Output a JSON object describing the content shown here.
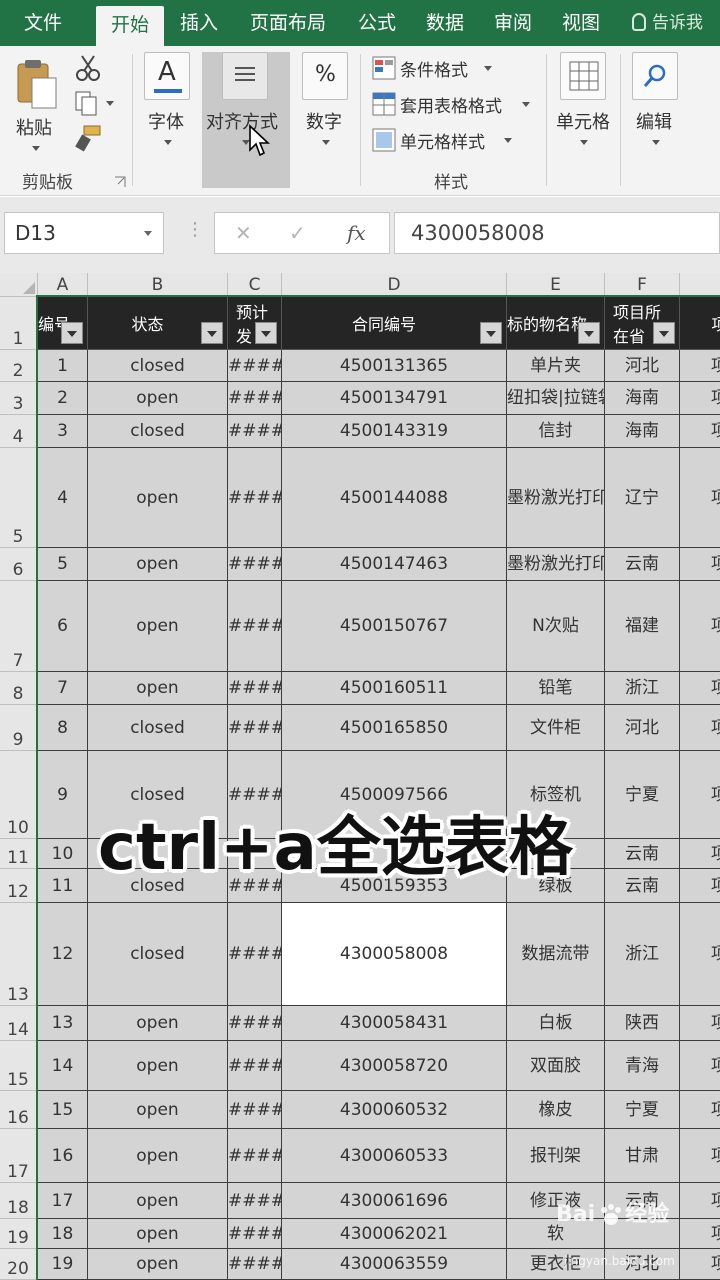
{
  "menu": {
    "tabs": [
      "文件",
      "开始",
      "插入",
      "页面布局",
      "公式",
      "数据",
      "审阅",
      "视图"
    ],
    "active_tab": "开始",
    "tell_me": "告诉我"
  },
  "ribbon": {
    "clipboard": {
      "paste": "粘贴",
      "group": "剪贴板"
    },
    "font": {
      "label": "字体",
      "icon": "A"
    },
    "alignment": {
      "label": "对齐方式"
    },
    "number": {
      "label": "数字",
      "icon": "%"
    },
    "styles": {
      "conditional": "条件格式",
      "table": "套用表格格式",
      "cell_styles": "单元格样式",
      "group": "样式"
    },
    "cells": {
      "label": "单元格"
    },
    "editing": {
      "label": "编辑"
    }
  },
  "formula_bar": {
    "name_box": "D13",
    "cancel": "✕",
    "enter": "✓",
    "fx": "fx",
    "value": "4300058008"
  },
  "columns": [
    "A",
    "B",
    "C",
    "D",
    "E",
    "F"
  ],
  "headers": {
    "A": "编号",
    "B": "状态",
    "C1": "预计",
    "C2": "发",
    "D": "合同编号",
    "E": "标的物名称",
    "F1": "项目所",
    "F2": "在省",
    "G": "项"
  },
  "rows": [
    {
      "n": "2",
      "a": "1",
      "b": "closed",
      "c": "####",
      "d": "4500131365",
      "e": "单片夹",
      "f": "河北",
      "g": "项"
    },
    {
      "n": "3",
      "a": "2",
      "b": "open",
      "c": "####",
      "d": "4500134791",
      "e": "纽扣袋|拉链袋",
      "f": "海南",
      "g": "项"
    },
    {
      "n": "4",
      "a": "3",
      "b": "closed",
      "c": "####",
      "d": "4500143319",
      "e": "信封",
      "f": "海南",
      "g": "项"
    },
    {
      "n": "5",
      "a": "4",
      "b": "open",
      "c": "####",
      "d": "4500144088",
      "e": "墨粉激光打印机",
      "f": "辽宁",
      "g": "项"
    },
    {
      "n": "6",
      "a": "5",
      "b": "open",
      "c": "####",
      "d": "4500147463",
      "e": "墨粉激光打印机",
      "f": "云南",
      "g": "项"
    },
    {
      "n": "7",
      "a": "6",
      "b": "open",
      "c": "####",
      "d": "4500150767",
      "e": "N次贴",
      "f": "福建",
      "g": "项"
    },
    {
      "n": "8",
      "a": "7",
      "b": "open",
      "c": "####",
      "d": "4500160511",
      "e": "铅笔",
      "f": "浙江",
      "g": "项"
    },
    {
      "n": "9",
      "a": "8",
      "b": "closed",
      "c": "####",
      "d": "4500165850",
      "e": "文件柜",
      "f": "河北",
      "g": "项"
    },
    {
      "n": "10",
      "a": "9",
      "b": "closed",
      "c": "####",
      "d": "4500097566",
      "e": "标签机",
      "f": "宁夏",
      "g": "项"
    },
    {
      "n": "11",
      "a": "10",
      "b": "",
      "c": "",
      "d": "",
      "e": "",
      "f": "云南",
      "g": "项"
    },
    {
      "n": "12",
      "a": "11",
      "b": "closed",
      "c": "####",
      "d": "4500159353",
      "e": "绿板",
      "f": "云南",
      "g": "项"
    },
    {
      "n": "13",
      "a": "12",
      "b": "closed",
      "c": "####",
      "d": "4300058008",
      "e": "数据流带",
      "f": "浙江",
      "g": "项"
    },
    {
      "n": "14",
      "a": "13",
      "b": "open",
      "c": "####",
      "d": "4300058431",
      "e": "白板",
      "f": "陕西",
      "g": "项"
    },
    {
      "n": "15",
      "a": "14",
      "b": "open",
      "c": "####",
      "d": "4300058720",
      "e": "双面胶",
      "f": "青海",
      "g": "项"
    },
    {
      "n": "16",
      "a": "15",
      "b": "open",
      "c": "####",
      "d": "4300060532",
      "e": "橡皮",
      "f": "宁夏",
      "g": "项"
    },
    {
      "n": "17",
      "a": "16",
      "b": "open",
      "c": "####",
      "d": "4300060533",
      "e": "报刊架",
      "f": "甘肃",
      "g": "项"
    },
    {
      "n": "18",
      "a": "17",
      "b": "open",
      "c": "####",
      "d": "4300061696",
      "e": "修正液",
      "f": "云南",
      "g": "项"
    },
    {
      "n": "19",
      "a": "18",
      "b": "open",
      "c": "####",
      "d": "4300062021",
      "e": "软",
      "f": "",
      "g": "项"
    },
    {
      "n": "20",
      "a": "19",
      "b": "open",
      "c": "####",
      "d": "4300063559",
      "e": "更衣柜",
      "f": "河北",
      "g": "项"
    }
  ],
  "header_row_number": "1",
  "caption": "ctrl+a全选表格",
  "watermark": {
    "brand": "Bai",
    "brand2": "经验",
    "url": "jingyan.baidu.com"
  },
  "colors": {
    "excel_green": "#217346",
    "header_fill": "#252525",
    "cell_fill": "#d4d4d4"
  }
}
